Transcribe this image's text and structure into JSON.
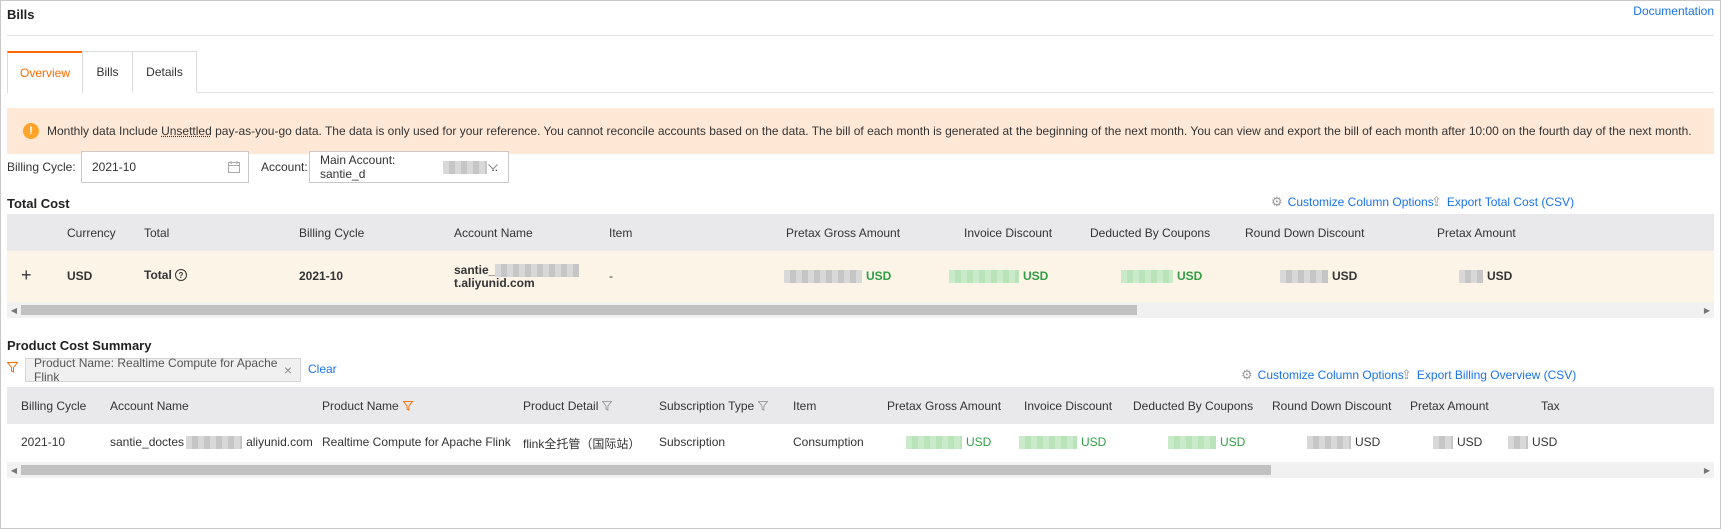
{
  "header": {
    "title": "Bills",
    "doc_link": "Documentation"
  },
  "tabs": [
    {
      "label": "Overview",
      "active": true
    },
    {
      "label": "Bills",
      "active": false
    },
    {
      "label": "Details",
      "active": false
    }
  ],
  "notice": {
    "icon": "info-icon",
    "pre": "Monthly data Include ",
    "underlined": "Unsettled",
    "post": " pay-as-you-go data. The data is only used for your reference. You cannot reconcile accounts based on the data. The bill of each month is generated at the beginning of the next month. You can view and export the bill of each month after 10:00 on the fourth day of the next month."
  },
  "filters": {
    "billing_cycle_label": "Billing Cycle:",
    "billing_cycle_value": "2021-10",
    "account_label": "Account:",
    "account_value": "Main Account: santie_d",
    "account_suffix": ".."
  },
  "total_cost": {
    "title": "Total Cost",
    "customize": "Customize Column Options",
    "export": "Export Total Cost (CSV)",
    "columns": [
      "Currency",
      "Total",
      "Billing Cycle",
      "Account Name",
      "Item",
      "Pretax Gross Amount",
      "Invoice Discount",
      "Deducted By Coupons",
      "Round Down Discount",
      "Pretax Amount"
    ],
    "row": {
      "expand": "+",
      "currency": "USD",
      "total": "Total",
      "billing_cycle": "2021-10",
      "account_line1": "santie_",
      "account_line2": "t.aliyunid.com",
      "item": "-",
      "currency_suffix": "USD"
    }
  },
  "product_summary": {
    "title": "Product Cost Summary",
    "filter_chip": "Product Name: Realtime Compute for Apache Flink",
    "clear": "Clear",
    "customize": "Customize Column Options",
    "export": "Export Billing Overview (CSV)",
    "columns": [
      "Billing Cycle",
      "Account Name",
      "Product Name",
      "Product Detail",
      "Subscription Type",
      "Item",
      "Pretax Gross Amount",
      "Invoice Discount",
      "Deducted By Coupons",
      "Round Down Discount",
      "Pretax Amount",
      "Tax"
    ],
    "row": {
      "billing_cycle": "2021-10",
      "account_pre": "santie_doctes",
      "account_post": "aliyunid.com",
      "product_name": "Realtime Compute for Apache Flink",
      "product_detail": "flink全托管（国际站）",
      "subscription_type": "Subscription",
      "item": "Consumption",
      "currency_suffix": "USD"
    }
  },
  "colors": {
    "accent": "#ff6a00",
    "link": "#1a73e8",
    "positive": "#2f9e44",
    "notice_bg": "#ffe8d6"
  }
}
